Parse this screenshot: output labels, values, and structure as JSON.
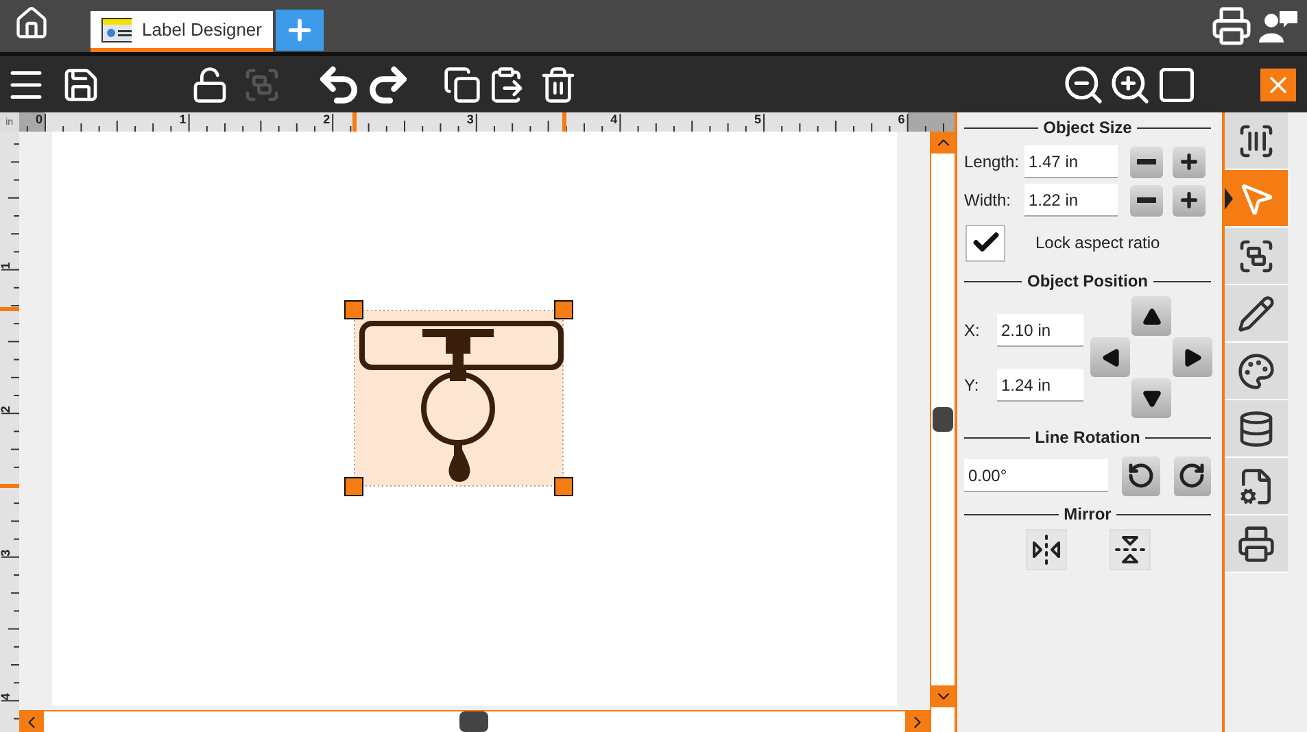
{
  "top_bar": {
    "tab": {
      "label": "Label Designer",
      "selected": true
    }
  },
  "toolbar": {
    "group_button": {
      "disabled": true
    }
  },
  "ruler": {
    "unit": "in",
    "top_labels": [
      "0",
      "1",
      "2",
      "3",
      "4",
      "5",
      "6"
    ],
    "left_labels": [
      "1",
      "2",
      "3",
      "4"
    ]
  },
  "object_size": {
    "title": "Object Size",
    "length_label": "Length:",
    "length": "1.47 in",
    "width_label": "Width:",
    "width": "1.22 in",
    "lock_label": "Lock aspect ratio",
    "lock_checked": true
  },
  "object_position": {
    "title": "Object Position",
    "x_label": "X:",
    "x": "2.10 in",
    "y_label": "Y:",
    "y": "1.24 in"
  },
  "line_rotation": {
    "title": "Line Rotation",
    "value": "0.00°"
  },
  "mirror": {
    "title": "Mirror"
  },
  "side_tabs": [
    {
      "selected": false
    },
    {
      "selected": true
    },
    {
      "selected": false
    },
    {
      "selected": false
    },
    {
      "selected": false
    },
    {
      "selected": false
    },
    {
      "selected": false
    },
    {
      "selected": false
    }
  ]
}
